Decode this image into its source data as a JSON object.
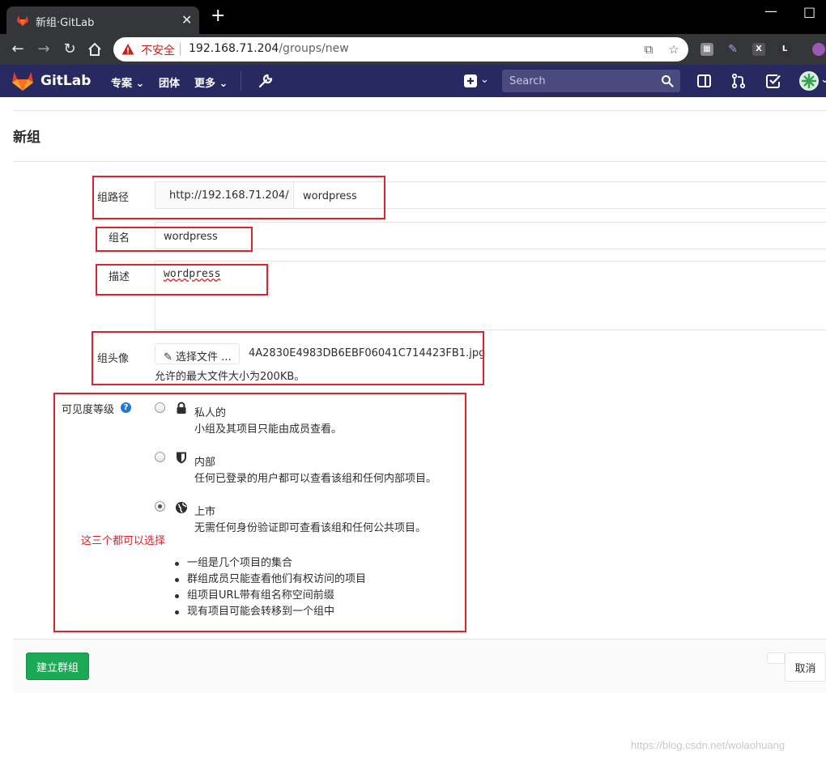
{
  "browser": {
    "tab_title": "新组·GitLab",
    "security_label": "不安全",
    "url_host": "192.168.71.204",
    "url_path": "/groups/new"
  },
  "gitlab_nav": {
    "brand": "GitLab",
    "menu": [
      {
        "label": "专案"
      },
      {
        "label": "团体"
      },
      {
        "label": "更多"
      }
    ],
    "search_placeholder": "Search"
  },
  "page": {
    "title": "新组"
  },
  "form": {
    "group_path": {
      "label": "组路径",
      "prefix": "http://192.168.71.204/",
      "value": "wordpress"
    },
    "group_name": {
      "label": "组名",
      "value": "wordpress"
    },
    "description": {
      "label": "描述",
      "value": "wordpress"
    },
    "avatar": {
      "label": "组头像",
      "button_label": "选择文件 ...",
      "file_name": "4A2830E4983DB6EBF06041C714423FB1.jpg",
      "size_hint": "允许的最大文件大小为200KB。"
    },
    "visibility": {
      "label": "可见度等级",
      "help_glyph": "?",
      "options": [
        {
          "title": "私人的",
          "description": "小组及其项目只能由成员查看。",
          "icon": "lock-icon",
          "selected": false
        },
        {
          "title": "内部",
          "description": "任何已登录的用户都可以查看该组和任何内部项目。",
          "icon": "shield-icon",
          "selected": false
        },
        {
          "title": "上市",
          "description": "无需任何身份验证即可查看该组和任何公共项目。",
          "icon": "globe-icon",
          "selected": true
        }
      ],
      "annotation": "这三个都可以选择",
      "bullets": [
        "一组是几个项目的集合",
        "群组成员只能查看他们有权访问的项目",
        "组项目URL带有组名称空间前缀",
        "现有项目可能会转移到一个组中"
      ]
    }
  },
  "actions": {
    "create_label": "建立群组",
    "cancel_label": "取消"
  },
  "watermark": "https://blog.csdn.net/wolaohuang",
  "colors": {
    "gitlab_nav_bg": "#292961",
    "annotation_red": "#e0222b",
    "create_green": "#1aaa55"
  }
}
